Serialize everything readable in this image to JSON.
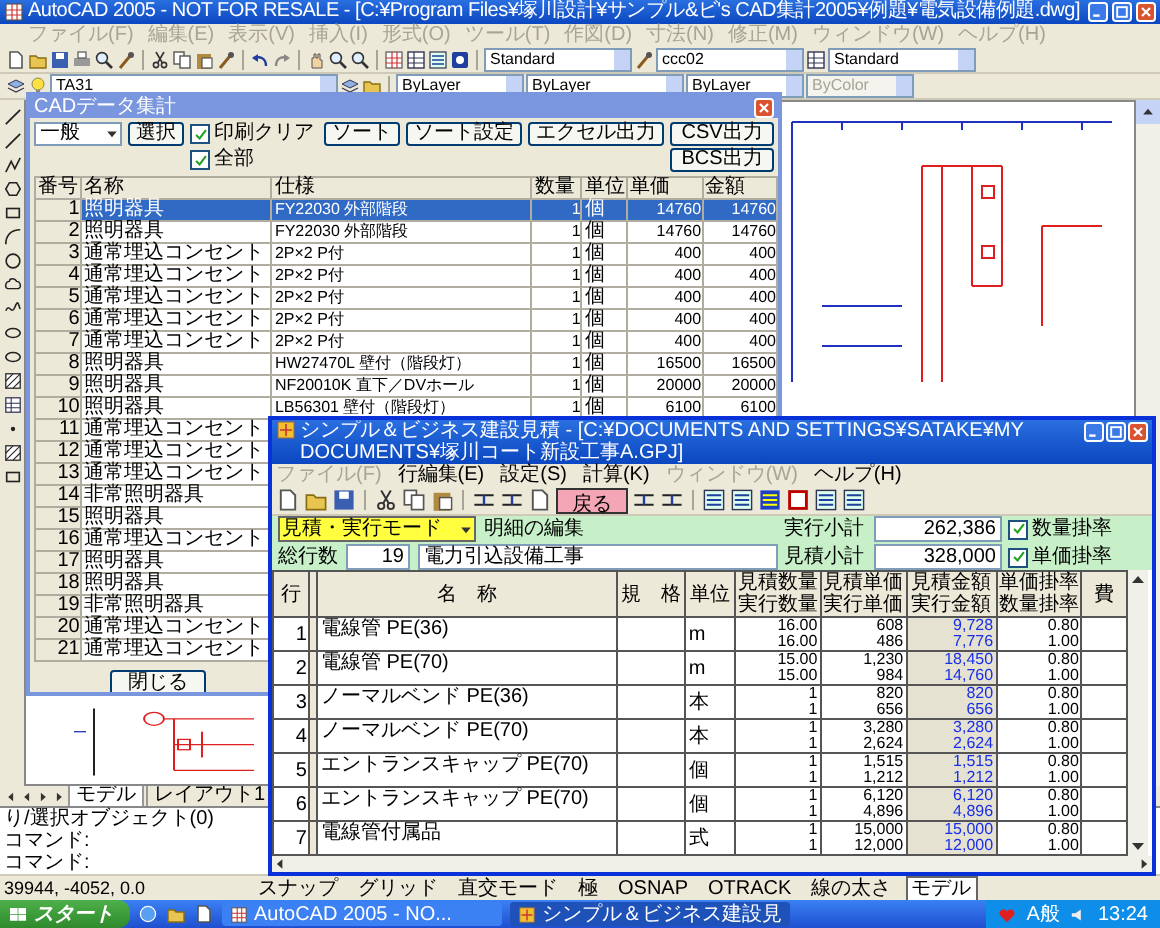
{
  "app_window": {
    "title": "AutoCAD 2005 - NOT FOR RESALE - [C:¥Program Files¥塚川設計¥サンプル&ビ's CAD集計2005¥例題¥電気設備例題.dwg]"
  },
  "menu": [
    {
      "label": "ファイル(F)",
      "disabled": true
    },
    {
      "label": "編集(E)",
      "disabled": true
    },
    {
      "label": "表示(V)",
      "disabled": true
    },
    {
      "label": "挿入(I)",
      "disabled": true
    },
    {
      "label": "形式(O)",
      "disabled": true
    },
    {
      "label": "ツール(T)",
      "disabled": true
    },
    {
      "label": "作図(D)",
      "disabled": true
    },
    {
      "label": "寸法(N)",
      "disabled": true
    },
    {
      "label": "修正(M)",
      "disabled": true
    },
    {
      "label": "ウィンドウ(W)",
      "disabled": true
    },
    {
      "label": "ヘルプ(H)",
      "disabled": true
    }
  ],
  "standard_toolbar": {
    "text_style": "Standard",
    "dim_style": "ccc02",
    "table_style": "Standard"
  },
  "layers_toolbar": {
    "layer": "TA31",
    "color_setting": "ByLayer",
    "linetype": "ByLayer",
    "lineweight": "ByLayer",
    "plot_style": {
      "value": "ByColor",
      "disabled": true
    }
  },
  "cad_dialog": {
    "title": "CADデータ集計",
    "controls_row_1": [
      {
        "kind": "select",
        "label": "一般"
      },
      {
        "kind": "button",
        "label": "選択"
      },
      {
        "kind": "checkbox",
        "label": "印刷クリア",
        "checked": true
      },
      {
        "kind": "button",
        "label": "ソート"
      },
      {
        "kind": "button",
        "label": "ソート設定"
      },
      {
        "kind": "button",
        "label": "エクセル出力"
      },
      {
        "kind": "button",
        "label": "CSV出力"
      }
    ],
    "controls_row_2": [
      {
        "kind": "checkbox",
        "label": "全部",
        "checked": true
      },
      {
        "kind": "button",
        "label": "BCS出力"
      }
    ],
    "table": {
      "columns": [
        "番号",
        "名称",
        "仕様",
        "数量",
        "単位",
        "単価",
        "金額"
      ],
      "rows": [
        {
          "no": "1",
          "name": "照明器具",
          "spec": "FY22030 外部階段",
          "qty": "1",
          "unit": "個",
          "price": "14760",
          "amount": "14760",
          "selected": true
        },
        {
          "no": "2",
          "name": "照明器具",
          "spec": "FY22030 外部階段",
          "qty": "1",
          "unit": "個",
          "price": "14760",
          "amount": "14760",
          "selected": false
        },
        {
          "no": "3",
          "name": "通常埋込コンセント",
          "spec": "2P×2 P付",
          "qty": "1",
          "unit": "個",
          "price": "400",
          "amount": "400",
          "selected": false
        },
        {
          "no": "4",
          "name": "通常埋込コンセント",
          "spec": "2P×2 P付",
          "qty": "1",
          "unit": "個",
          "price": "400",
          "amount": "400",
          "selected": false
        },
        {
          "no": "5",
          "name": "通常埋込コンセント",
          "spec": "2P×2 P付",
          "qty": "1",
          "unit": "個",
          "price": "400",
          "amount": "400",
          "selected": false
        },
        {
          "no": "6",
          "name": "通常埋込コンセント",
          "spec": "2P×2 P付",
          "qty": "1",
          "unit": "個",
          "price": "400",
          "amount": "400",
          "selected": false
        },
        {
          "no": "7",
          "name": "通常埋込コンセント",
          "spec": "2P×2 P付",
          "qty": "1",
          "unit": "個",
          "price": "400",
          "amount": "400",
          "selected": false
        },
        {
          "no": "8",
          "name": "照明器具",
          "spec": "HW27470L 壁付（階段灯）",
          "qty": "1",
          "unit": "個",
          "price": "16500",
          "amount": "16500",
          "selected": false
        },
        {
          "no": "9",
          "name": "照明器具",
          "spec": "NF20010K 直下／DVホール",
          "qty": "1",
          "unit": "個",
          "price": "20000",
          "amount": "20000",
          "selected": false
        },
        {
          "no": "10",
          "name": "照明器具",
          "spec": "LB56301 壁付（階段灯）",
          "qty": "1",
          "unit": "個",
          "price": "6100",
          "amount": "6100",
          "selected": false
        },
        {
          "no": "11",
          "name": "通常埋込コンセント",
          "selected": false
        },
        {
          "no": "12",
          "name": "通常埋込コンセント",
          "selected": false
        },
        {
          "no": "13",
          "name": "通常埋込コンセント",
          "selected": false
        },
        {
          "no": "14",
          "name": "非常照明器具",
          "selected": false
        },
        {
          "no": "15",
          "name": "照明器具",
          "selected": false
        },
        {
          "no": "16",
          "name": "通常埋込コンセント",
          "selected": false
        },
        {
          "no": "17",
          "name": "照明器具",
          "selected": false
        },
        {
          "no": "18",
          "name": "照明器具",
          "selected": false
        },
        {
          "no": "19",
          "name": "非常照明器具",
          "selected": false
        },
        {
          "no": "20",
          "name": "通常埋込コンセント",
          "selected": false
        },
        {
          "no": "21",
          "name": "通常埋込コンセント",
          "selected": false
        }
      ]
    },
    "close_button": "閉じる"
  },
  "layout_tabs": [
    {
      "label": "モデル",
      "selected": true
    },
    {
      "label": "レイアウト1",
      "selected": false
    }
  ],
  "command_lines": [
    "り/選択オブジェクト(0)",
    "コマンド:",
    "コマンド:"
  ],
  "status_bar": {
    "coordinates": "39944, -4052, 0.0",
    "toggles": [
      {
        "label": "スナップ",
        "on": false
      },
      {
        "label": "グリッド",
        "on": false
      },
      {
        "label": "直交モード",
        "on": false
      },
      {
        "label": "極",
        "on": false
      },
      {
        "label": "OSNAP",
        "on": false
      },
      {
        "label": "OTRACK",
        "on": false
      },
      {
        "label": "線の太さ",
        "on": false
      },
      {
        "label": "モデル",
        "on": true
      }
    ]
  },
  "estimate_window": {
    "title": "シンプル＆ビジネス建設見積 - [C:¥DOCUMENTS AND SETTINGS¥SATAKE¥MY DOCUMENTS¥塚川コート新設工事A.GPJ]",
    "menu": [
      {
        "label": "ファイル(F)",
        "disabled": true
      },
      {
        "label": "行編集(E)",
        "disabled": false
      },
      {
        "label": "設定(S)",
        "disabled": false
      },
      {
        "label": "計算(K)",
        "disabled": false
      },
      {
        "label": "ウィンドウ(W)",
        "disabled": true
      },
      {
        "label": "ヘルプ(H)",
        "disabled": false
      }
    ],
    "back_button": "戻る",
    "mode": "見積・実行モード",
    "section_label": "明細の編集",
    "total_rows_label": "総行数",
    "total_rows": "19",
    "work_name": "電力引込設備工事",
    "subtotals": [
      {
        "label": "実行小計",
        "value": "262,386",
        "option": "数量掛率",
        "checked": true
      },
      {
        "label": "見積小計",
        "value": "328,000",
        "option": "単価掛率",
        "checked": true
      }
    ],
    "table": {
      "columns": [
        "行",
        "名　称",
        "規　格",
        "単位",
        "見積数量実行数量",
        "見積単価実行単価",
        "見積金額実行金額",
        "単価掛率数量掛率",
        "費"
      ],
      "rows": [
        {
          "no": "1",
          "name": "電線管 PE(36)",
          "unit": "m",
          "qty": [
            "16.00",
            "16.00"
          ],
          "price": [
            "608",
            "486"
          ],
          "amount": [
            "9,728",
            "7,776"
          ],
          "rate": [
            "0.80",
            "1.00"
          ]
        },
        {
          "no": "2",
          "name": "電線管 PE(70)",
          "unit": "m",
          "qty": [
            "15.00",
            "15.00"
          ],
          "price": [
            "1,230",
            "984"
          ],
          "amount": [
            "18,450",
            "14,760"
          ],
          "rate": [
            "0.80",
            "1.00"
          ]
        },
        {
          "no": "3",
          "name": "ノーマルベンド PE(36)",
          "unit": "本",
          "qty": [
            "1",
            "1"
          ],
          "price": [
            "820",
            "656"
          ],
          "amount": [
            "820",
            "656"
          ],
          "rate": [
            "0.80",
            "1.00"
          ]
        },
        {
          "no": "4",
          "name": "ノーマルベンド PE(70)",
          "unit": "本",
          "qty": [
            "1",
            "1"
          ],
          "price": [
            "3,280",
            "2,624"
          ],
          "amount": [
            "3,280",
            "2,624"
          ],
          "rate": [
            "0.80",
            "1.00"
          ]
        },
        {
          "no": "5",
          "name": "エントランスキャップ PE(70)",
          "unit": "個",
          "qty": [
            "1",
            "1"
          ],
          "price": [
            "1,515",
            "1,212"
          ],
          "amount": [
            "1,515",
            "1,212"
          ],
          "rate": [
            "0.80",
            "1.00"
          ]
        },
        {
          "no": "6",
          "name": "エントランスキャップ PE(70)",
          "unit": "個",
          "qty": [
            "1",
            "1"
          ],
          "price": [
            "6,120",
            "4,896"
          ],
          "amount": [
            "6,120",
            "4,896"
          ],
          "rate": [
            "0.80",
            "1.00"
          ]
        },
        {
          "no": "7",
          "name": "電線管付属品",
          "unit": "式",
          "qty": [
            "1",
            "1"
          ],
          "price": [
            "15,000",
            "12,000"
          ],
          "amount": [
            "15,000",
            "12,000"
          ],
          "rate": [
            "0.80",
            "1.00"
          ]
        }
      ]
    }
  },
  "taskbar": {
    "start": "スタート",
    "tasks": [
      {
        "label": "AutoCAD 2005 - NO...",
        "selected": false
      },
      {
        "label": "シンプル＆ビジネス建設見",
        "selected": true
      }
    ],
    "ime": "A般",
    "clock": "13:24"
  }
}
